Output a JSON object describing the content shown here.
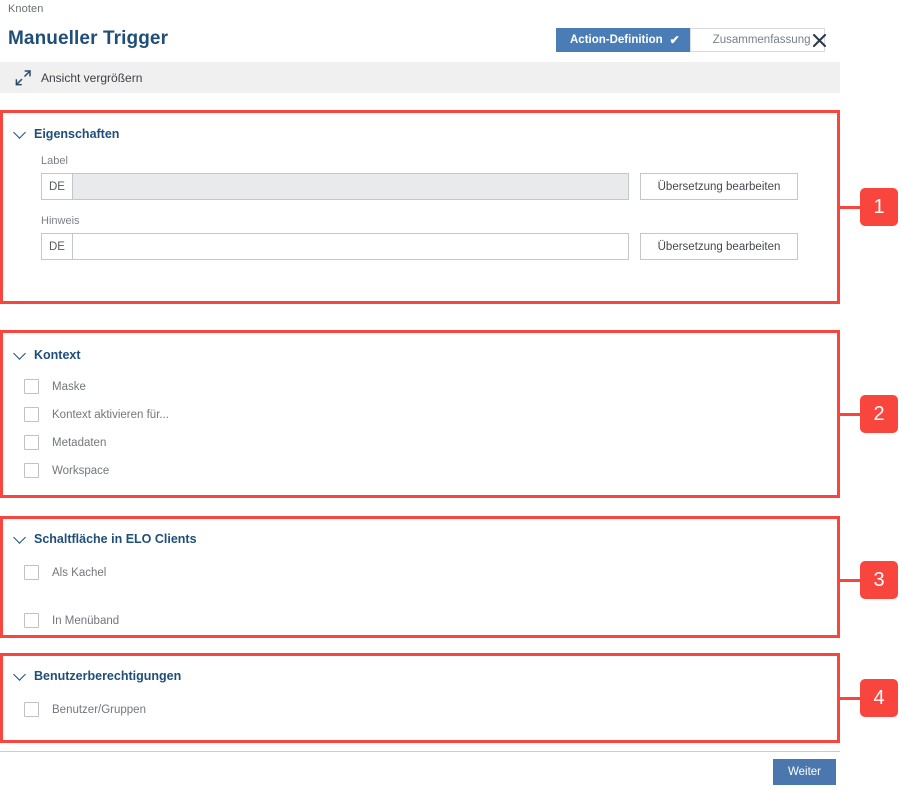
{
  "header": {
    "breadcrumb": "Knoten",
    "title": "Manueller Trigger",
    "close_icon": "close-icon"
  },
  "wizard": {
    "tabs": [
      {
        "label": "Action-Definition",
        "state": "active",
        "check": "✔"
      },
      {
        "label": "Zusammenfassung",
        "state": "inactive"
      }
    ]
  },
  "toolbar": {
    "icon": "expand-view-icon",
    "label": "Ansicht vergrößern"
  },
  "sections": [
    {
      "id": "eigenschaften",
      "title": "Eigenschaften",
      "marker": "1",
      "fields": [
        {
          "label": "Label",
          "lang": "DE",
          "value": "",
          "placeholder": "",
          "disabled": true,
          "button": "Übersetzung bearbeiten"
        },
        {
          "label": "Hinweis",
          "lang": "DE",
          "value": "",
          "placeholder": "",
          "disabled": false,
          "button": "Übersetzung bearbeiten"
        }
      ]
    },
    {
      "id": "kontext",
      "title": "Kontext",
      "marker": "2",
      "checkboxes": [
        {
          "label": "Maske",
          "checked": false
        },
        {
          "label": "Kontext aktivieren für...",
          "checked": false
        },
        {
          "label": "Metadaten",
          "checked": false
        },
        {
          "label": "Workspace",
          "checked": false
        }
      ]
    },
    {
      "id": "schaltflaeche",
      "title": "Schaltfläche in ELO Clients",
      "marker": "3",
      "checkboxes": [
        {
          "label": "Als Kachel",
          "checked": false
        },
        {
          "label": "In Menüband",
          "checked": false
        }
      ]
    },
    {
      "id": "benutzerberechtigungen",
      "title": "Benutzerberechtigungen",
      "marker": "4",
      "checkboxes": [
        {
          "label": "Benutzer/Gruppen",
          "checked": false
        }
      ]
    }
  ],
  "footer": {
    "next_label": "Weiter"
  },
  "colors": {
    "annotation_red": "#f8463f",
    "accent_blue": "#1f4e79",
    "tab_blue": "#4a7cb5",
    "button_blue": "#4a77ad"
  }
}
